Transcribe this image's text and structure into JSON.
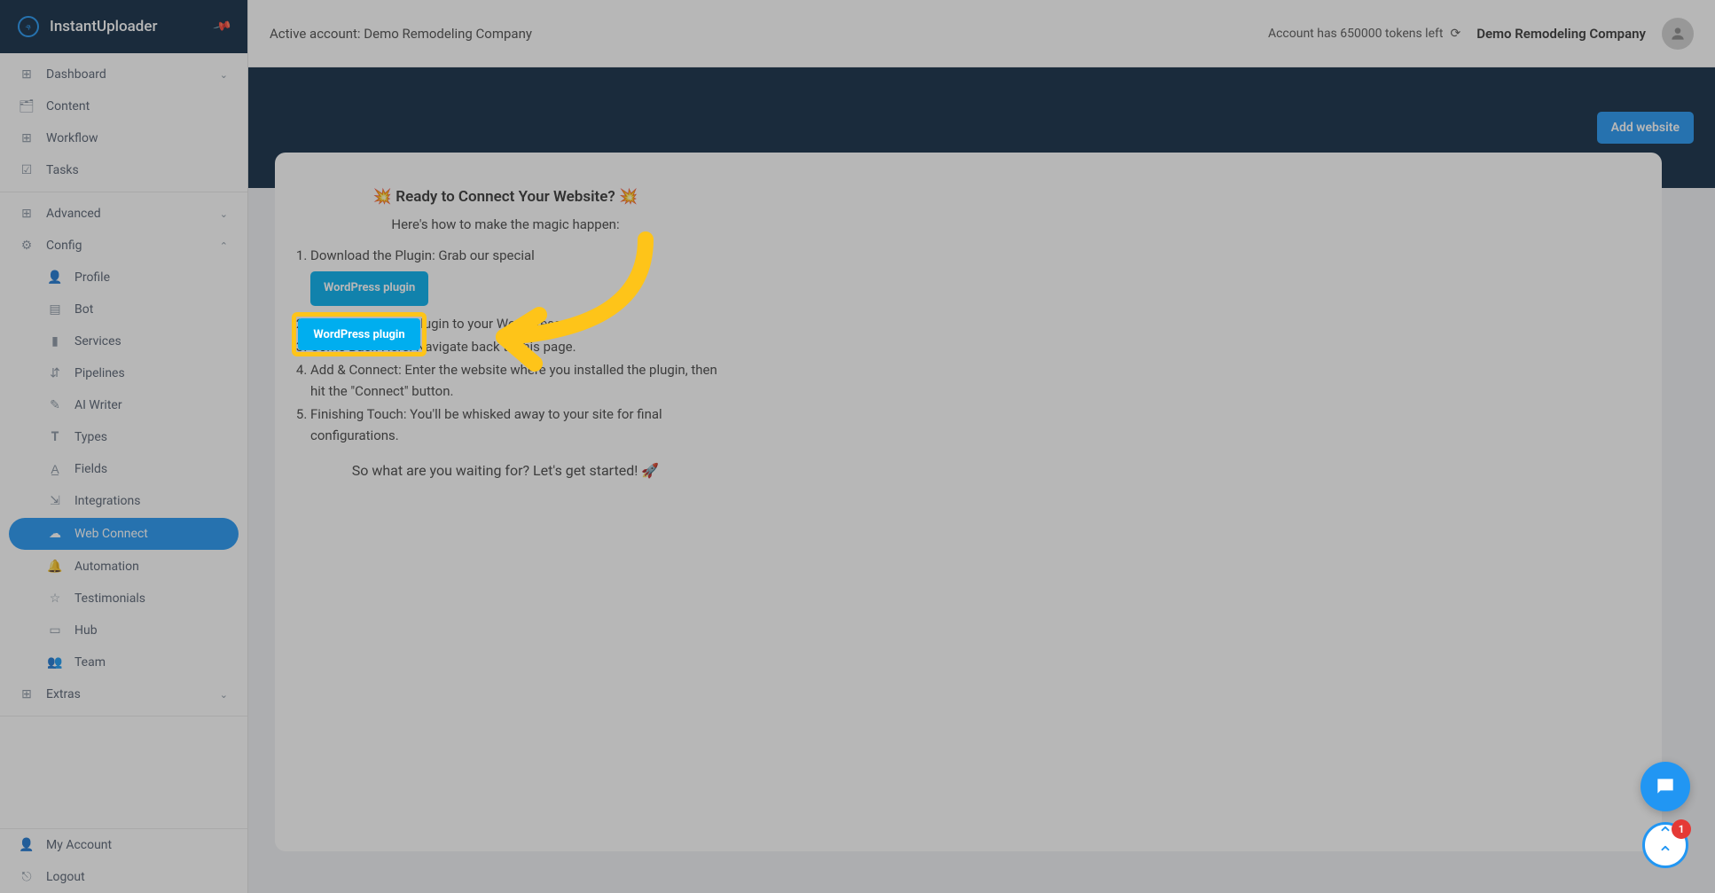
{
  "brand": "InstantUploader",
  "topbar": {
    "active_account_label": "Active account: Demo Remodeling Company",
    "tokens_text": "Account has 650000 tokens left",
    "company_name": "Demo Remodeling Company"
  },
  "actions": {
    "add_website": "Add website"
  },
  "sidebar": {
    "main": [
      {
        "label": "Dashboard",
        "icon": "◫",
        "expandable": true
      },
      {
        "label": "Content",
        "icon": "🗂"
      },
      {
        "label": "Workflow",
        "icon": "⊞"
      },
      {
        "label": "Tasks",
        "icon": "☑"
      }
    ],
    "section2": [
      {
        "label": "Advanced",
        "icon": "⊞",
        "expandable": true,
        "open": false
      },
      {
        "label": "Config",
        "icon": "⚙",
        "expandable": true,
        "open": true
      }
    ],
    "config_sub": [
      {
        "label": "Profile",
        "icon": "👤"
      },
      {
        "label": "Bot",
        "icon": "▤"
      },
      {
        "label": "Services",
        "icon": "▮"
      },
      {
        "label": "Pipelines",
        "icon": "⇵"
      },
      {
        "label": "AI Writer",
        "icon": "✎"
      },
      {
        "label": "Types",
        "icon": "𝐓"
      },
      {
        "label": "Fields",
        "icon": "A̲"
      },
      {
        "label": "Integrations",
        "icon": "⇲"
      },
      {
        "label": "Web Connect",
        "icon": "☁",
        "active": true
      },
      {
        "label": "Automation",
        "icon": "🔔"
      },
      {
        "label": "Testimonials",
        "icon": "☆"
      },
      {
        "label": "Hub",
        "icon": "▭"
      },
      {
        "label": "Team",
        "icon": "👥"
      }
    ],
    "extras": {
      "label": "Extras",
      "icon": "⊞"
    },
    "footer": [
      {
        "label": "My Account",
        "icon": "👤"
      },
      {
        "label": "Logout",
        "icon": "⎋"
      }
    ]
  },
  "content": {
    "title": "💥 Ready to Connect Your Website? 💥",
    "subtitle": "Here's how to make the magic happen:",
    "steps": [
      "Download the Plugin: Grab our special",
      "Install It: Add the plugin to your WordPress site.",
      "Come Back Here: Navigate back to this page.",
      "Add & Connect: Enter the website where you installed the plugin, then hit the \"Connect\" button.",
      "Finishing Touch: You'll be whisked away to your site for final configurations."
    ],
    "plugin_button": "WordPress plugin",
    "closing": "So what are you waiting for? Let's get started! 🚀"
  },
  "floaters": {
    "badge_count": "1"
  }
}
